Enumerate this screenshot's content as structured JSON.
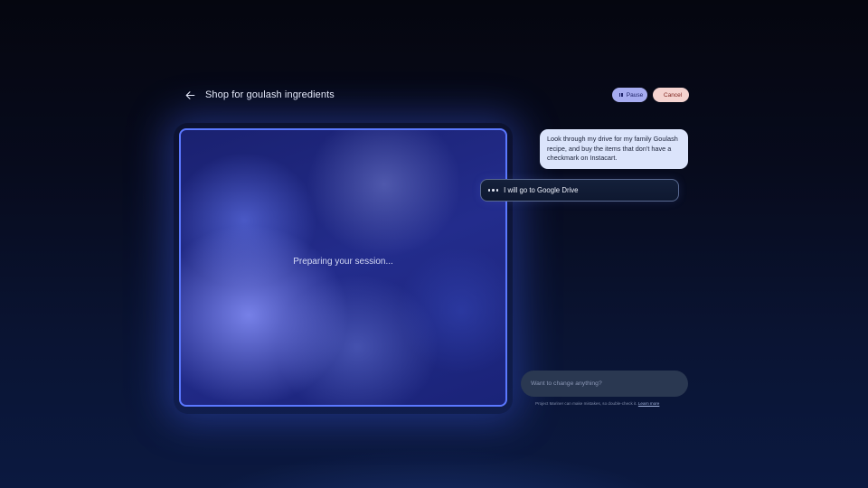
{
  "header": {
    "title": "Shop for goulash ingredients",
    "back_icon": "arrow-left-icon"
  },
  "controls": {
    "pause_label": "Pause",
    "cancel_label": "Cancel",
    "pause_color": "#a6acf0",
    "cancel_color": "#f4d3d0"
  },
  "session": {
    "status": "Preparing your session...",
    "border_color": "#5b78ff"
  },
  "chat": {
    "user_message": "Look through my drive for my family Goulash recipe, and buy the items that don't have a checkmark on Instacart.",
    "agent_status": "I will go to Google Drive"
  },
  "input": {
    "placeholder": "Want to change anything?",
    "value": ""
  },
  "disclaimer": {
    "text": "Project Mariner can make mistakes, so double-check it.",
    "link_label": "Learn more"
  }
}
